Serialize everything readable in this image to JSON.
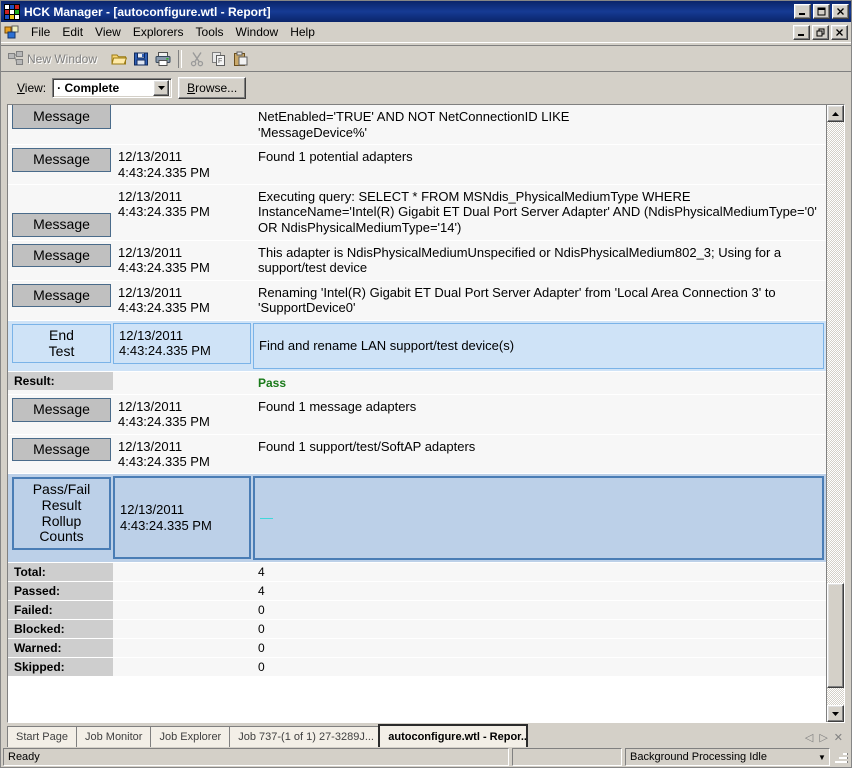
{
  "window": {
    "title": "HCK Manager - [autoconfigure.wtl - Report]",
    "app_icon": "hck-grid-icon",
    "controls": {
      "minimize": "minimize-icon",
      "maximize": "maximize-icon",
      "close": "close-icon"
    },
    "mdi_controls": {
      "minimize": "mdi-minimize-icon",
      "restore": "mdi-restore-icon",
      "close": "mdi-close-icon"
    }
  },
  "menu": {
    "items": [
      {
        "label": "File"
      },
      {
        "label": "Edit"
      },
      {
        "label": "View"
      },
      {
        "label": "Explorers"
      },
      {
        "label": "Tools"
      },
      {
        "label": "Window"
      },
      {
        "label": "Help"
      }
    ]
  },
  "toolbar": {
    "new_window_label": "New Window",
    "buttons": [
      {
        "name": "new-window-icon"
      },
      {
        "name": "open-folder-icon"
      },
      {
        "name": "save-icon"
      },
      {
        "name": "print-icon"
      },
      {
        "name": "cut-icon"
      },
      {
        "name": "copy-icon"
      },
      {
        "name": "paste-icon"
      }
    ]
  },
  "viewbar": {
    "view_label": "View:",
    "view_label_mnemonic": "V",
    "view_label_rest": "iew:",
    "view_value": "· Complete",
    "browse_mnemonic": "B",
    "browse_rest": "rowse...",
    "browse_label": "Browse..."
  },
  "report": {
    "rows": [
      {
        "kind": "message",
        "badge": "Message",
        "date": "",
        "message": "NetEnabled='TRUE' AND NOT NetConnectionID LIKE\n'MessageDevice%'",
        "clipped_top": true
      },
      {
        "kind": "message",
        "badge": "Message",
        "date": "12/13/2011\n4:43:24.335 PM",
        "message": "Found 1 potential adapters"
      },
      {
        "kind": "message",
        "badge": "Message",
        "date": "12/13/2011\n4:43:24.335 PM",
        "message": "Executing query: SELECT * FROM MSNdis_PhysicalMediumType WHERE InstanceName='Intel(R) Gigabit ET Dual Port Server Adapter' AND (NdisPhysicalMediumType='0' OR NdisPhysicalMediumType='14')"
      },
      {
        "kind": "message",
        "badge": "Message",
        "date": "12/13/2011\n4:43:24.335 PM",
        "message": "This adapter is NdisPhysicalMediumUnspecified or NdisPhysicalMedium802_3; Using for a support/test device"
      },
      {
        "kind": "message",
        "badge": "Message",
        "date": "12/13/2011\n4:43:24.335 PM",
        "message": "Renaming 'Intel(R) Gigabit ET Dual Port Server Adapter' from 'Local Area Connection 3' to 'SupportDevice0'"
      },
      {
        "kind": "endtest",
        "badge": "End\nTest",
        "date": "12/13/2011\n4:43:24.335 PM",
        "message": "Find and rename LAN support/test device(s)"
      },
      {
        "kind": "result",
        "badge": "Result:",
        "date": "",
        "message": "Pass",
        "message_color": "#1a7a1a"
      },
      {
        "kind": "message",
        "badge": "Message",
        "date": "12/13/2011\n4:43:24.335 PM",
        "message": "Found 1 message adapters"
      },
      {
        "kind": "message",
        "badge": "Message",
        "date": "12/13/2011\n4:43:24.335 PM",
        "message": "Found 1 support/test/SoftAP adapters"
      },
      {
        "kind": "rollup",
        "badge": "Pass/Fail\nResult\nRollup\nCounts",
        "date": "12/13/2011\n4:43:24.335 PM",
        "message": "—"
      }
    ],
    "counts": [
      {
        "label": "Total:",
        "value": "4"
      },
      {
        "label": "Passed:",
        "value": "4"
      },
      {
        "label": "Failed:",
        "value": "0"
      },
      {
        "label": "Blocked:",
        "value": "0"
      },
      {
        "label": "Warned:",
        "value": "0"
      },
      {
        "label": "Skipped:",
        "value": "0"
      }
    ]
  },
  "scrollbar": {
    "up_icon": "scroll-up-icon",
    "down_icon": "scroll-down-icon"
  },
  "tabs": {
    "items": [
      {
        "label": "Start Page",
        "active": false
      },
      {
        "label": "Job Monitor",
        "active": false
      },
      {
        "label": "Job Explorer",
        "active": false
      },
      {
        "label": "Job 737-(1 of 1) 27-3289J...",
        "active": false
      },
      {
        "label": "autoconfigure.wtl - Repor...",
        "active": true
      }
    ],
    "nav": {
      "prev": "◁",
      "next": "▷",
      "close": "✕"
    }
  },
  "statusbar": {
    "status": "Ready",
    "middle": "",
    "background_task": "Background Processing Idle"
  },
  "colors": {
    "title_bar": "#0a246a",
    "face": "#d4d0c8",
    "highlight_row": "#cfe3f7",
    "rollup_row": "#bcd0e8",
    "pass_green": "#1a7a1a",
    "badge_gray": "#c0c0c0"
  }
}
